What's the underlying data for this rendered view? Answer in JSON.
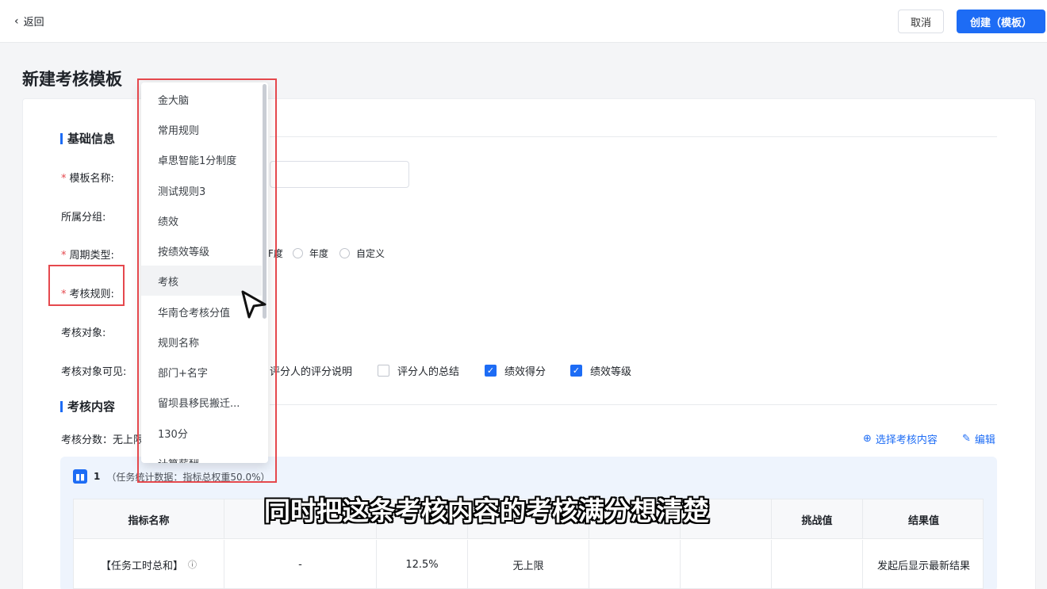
{
  "topbar": {
    "back_label": "返回",
    "cancel_label": "取消",
    "create_label": "创建（模板）"
  },
  "page_title": "新建考核模板",
  "basic_section": {
    "title": "基础信息",
    "fields": {
      "template_name": "模板名称:",
      "group": "所属分组:",
      "cycle_type": "周期类型:",
      "rule": "考核规则:",
      "target": "考核对象:",
      "target_visible": "考核对象可见:"
    },
    "cycle_options": [
      {
        "label": "年度",
        "selected": false
      },
      {
        "label": "年度",
        "selected": false
      },
      {
        "label": "自定义",
        "selected": false
      }
    ],
    "cycle_partial_prefix": "F度",
    "visible_options": [
      {
        "label": "评分人的评分说明",
        "checked": false
      },
      {
        "label": "评分人的总结",
        "checked": false
      },
      {
        "label": "绩效得分",
        "checked": true
      },
      {
        "label": "绩效等级",
        "checked": true
      }
    ]
  },
  "content_section": {
    "title": "考核内容",
    "score_label": "考核分数：无上限",
    "select_link": "选择考核内容",
    "edit_link": "编辑",
    "group_index": "1",
    "group_desc": "（任务统计数据：指标总权重50.0%）",
    "table": {
      "headers": [
        "指标名称",
        "",
        "",
        "",
        "",
        "",
        "挑战值",
        "结果值"
      ],
      "rows": [
        [
          "【任务工时总和】",
          "-",
          "12.5%",
          "无上限",
          "",
          "",
          "",
          "发起后显示最新结果"
        ]
      ]
    }
  },
  "rule_dropdown": {
    "items": [
      "金大脑",
      "常用规则",
      "卓思智能1分制度",
      "测试规则3",
      "绩效",
      "按绩效等级",
      "考核",
      "华南仓考核分值",
      "规则名称",
      "部门+名字",
      "留坝县移民搬迁...",
      "130分",
      "计算薪酬"
    ],
    "hovered_index": 6
  },
  "subtitle": "同时把这条考核内容的考核满分想清楚",
  "colors": {
    "primary": "#1d6cf5",
    "highlight": "#e5484d"
  }
}
